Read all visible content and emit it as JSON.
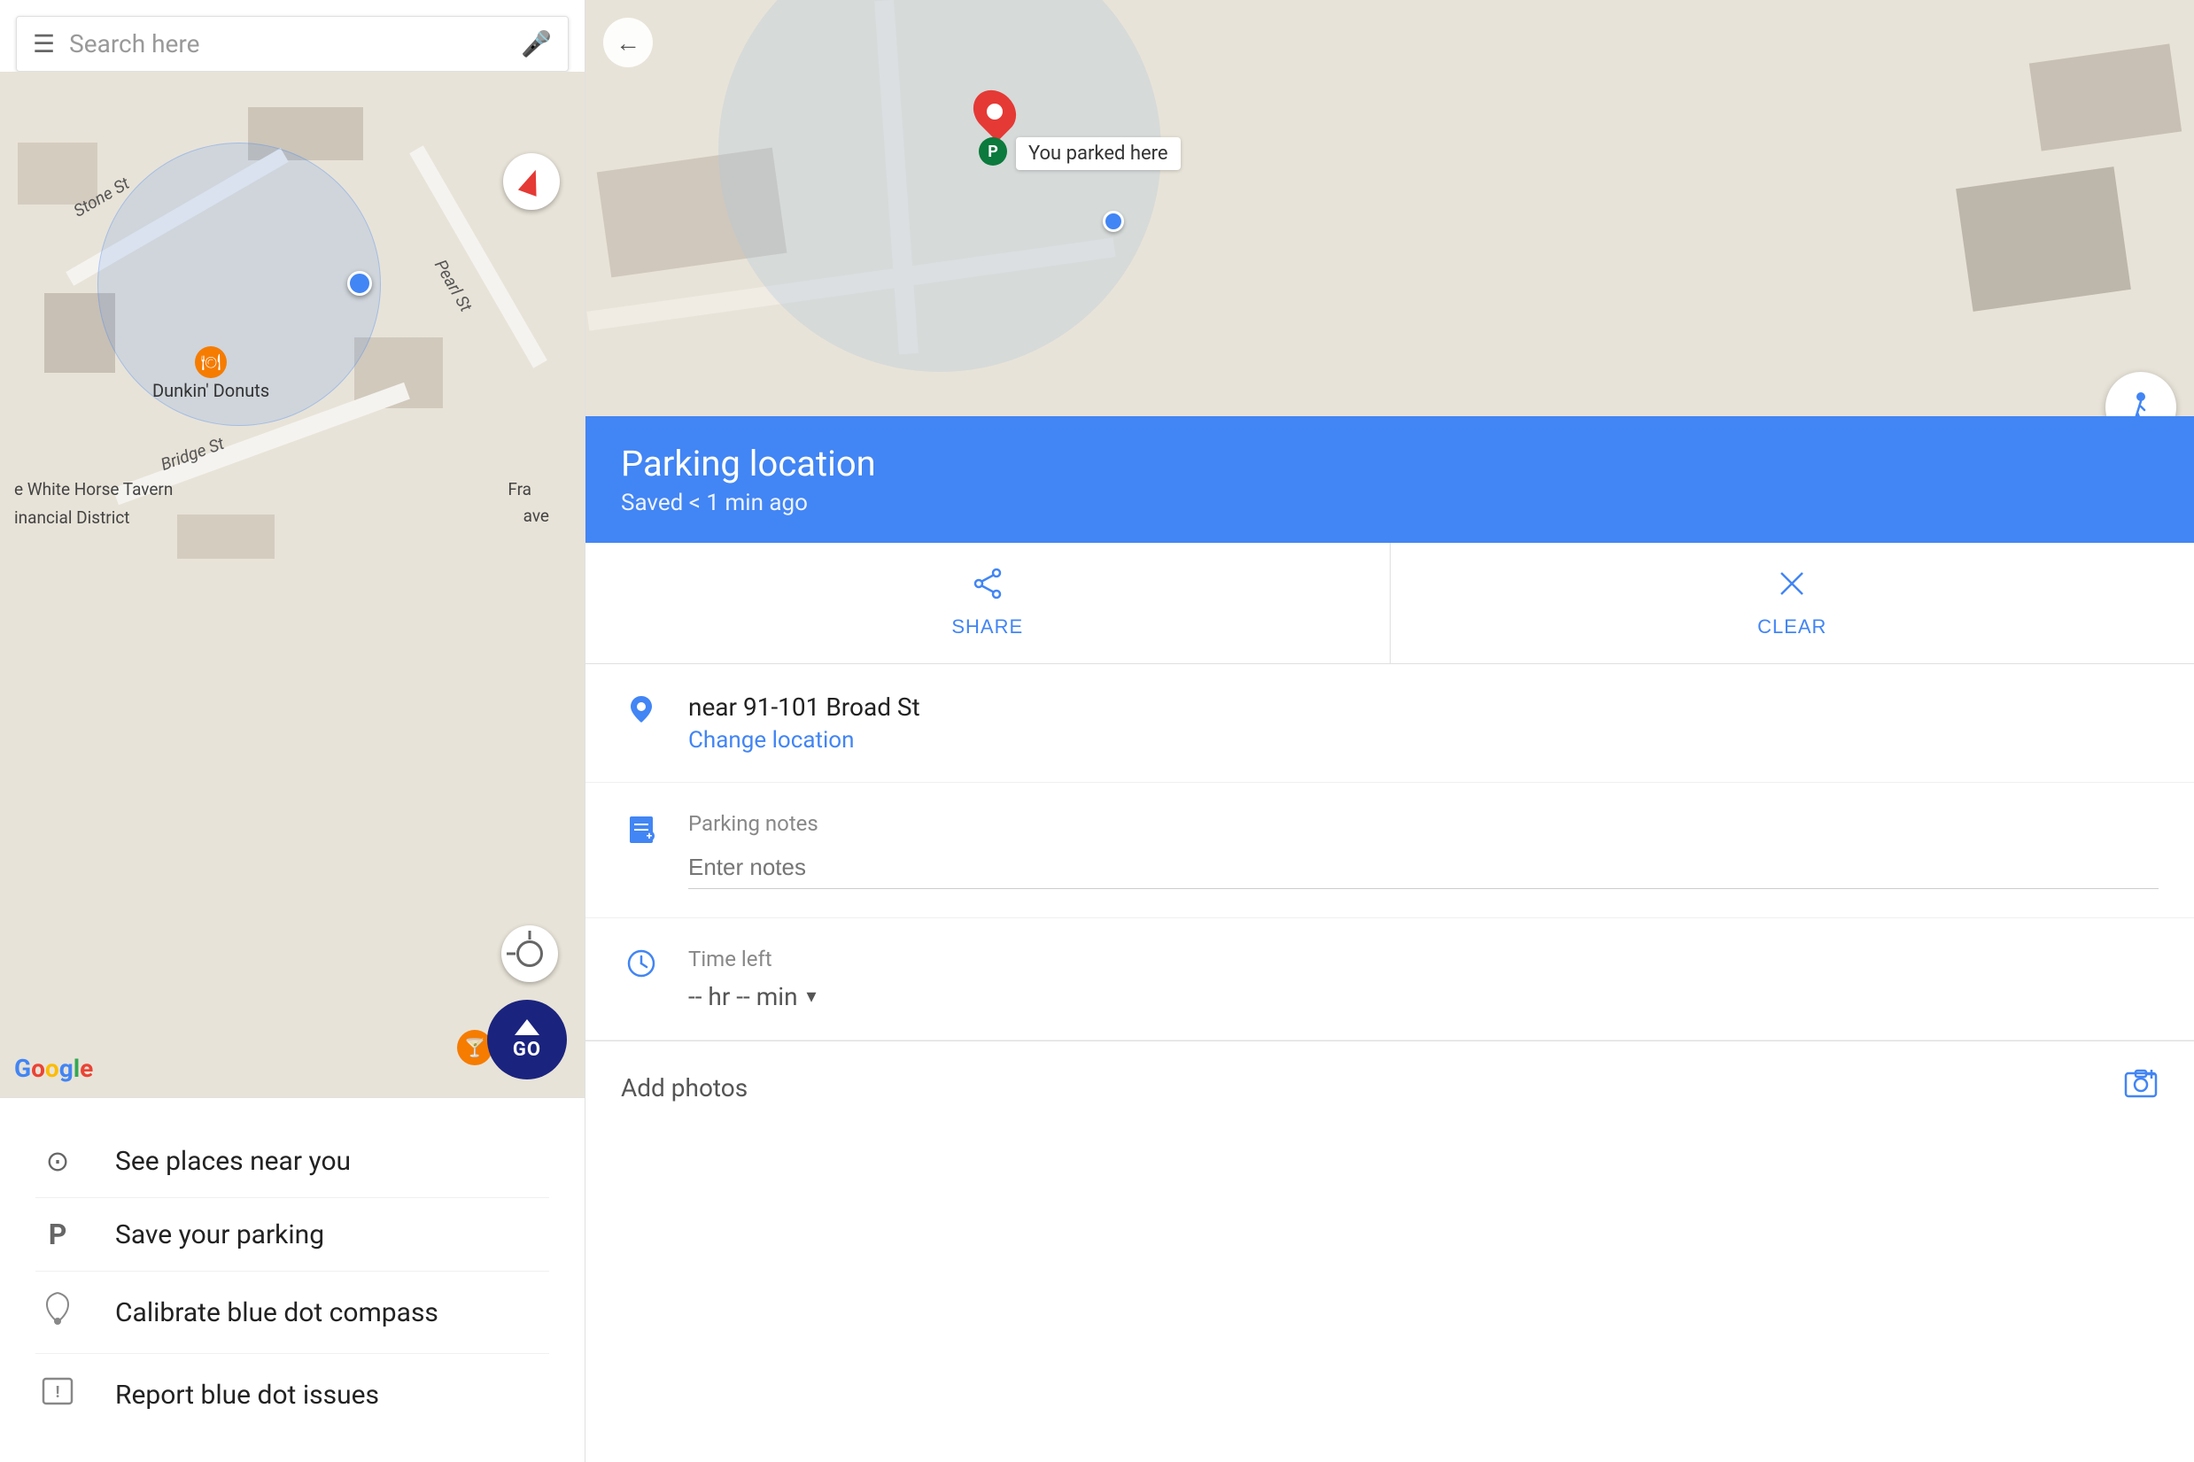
{
  "left": {
    "search_placeholder": "Search here",
    "compass_label": "Compass",
    "go_label": "GO",
    "map_labels": {
      "stone_st": "Stone St",
      "bridge_st": "Bridge St",
      "pearl_st": "Pearl St",
      "dunkin": "Dunkin' Donuts",
      "white_horse": "e White Horse Tavern",
      "financial": "inancial District",
      "fra": "Fra",
      "ave": "ave"
    },
    "google_logo": "Google"
  },
  "left_menu": {
    "items": [
      {
        "id": "see-places",
        "icon": "⊙",
        "label": "See places near you"
      },
      {
        "id": "save-parking",
        "icon": "P",
        "label": "Save your parking"
      },
      {
        "id": "calibrate",
        "icon": "((·))",
        "label": "Calibrate blue dot compass"
      },
      {
        "id": "report",
        "icon": "⚠",
        "label": "Report blue dot issues"
      }
    ]
  },
  "right": {
    "back_label": "←",
    "parked_here_label": "You parked here",
    "parking_location_title": "Parking location",
    "parking_saved_subtitle": "Saved < 1 min ago",
    "share_label": "SHARE",
    "clear_label": "CLEAR",
    "address": "near 91-101 Broad St",
    "change_location_label": "Change location",
    "parking_notes_label": "Parking notes",
    "enter_notes_placeholder": "Enter notes",
    "time_left_label": "Time left",
    "time_left_value": "-- hr -- min",
    "add_photos_label": "Add photos"
  }
}
